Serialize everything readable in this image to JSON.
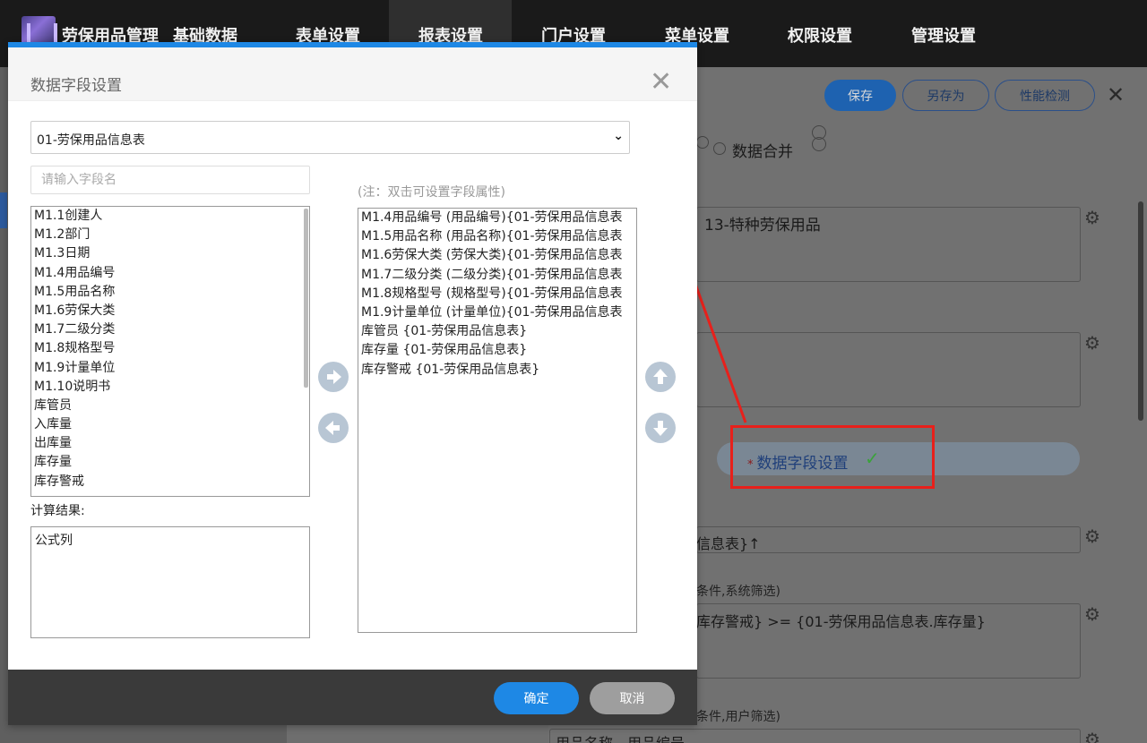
{
  "app": {
    "title": "劳保用品管理",
    "nav": [
      "基础数据",
      "表单设置",
      "报表设置",
      "门户设置",
      "菜单设置",
      "权限设置",
      "管理设置"
    ]
  },
  "background": {
    "buttons": {
      "save": "保存",
      "save_as": "另存为",
      "perf_check": "性能检测"
    },
    "radio_label": "数据合并",
    "field1_value": "13-特种劳保用品",
    "data_field_setting": "数据字段设置",
    "required_star": "*",
    "field3_value": "信息表}↑",
    "cond1_label": "条件,系统筛选)",
    "cond1_value": "库存警戒} >= {01-劳保用品信息表.库存量}",
    "cond2_label": "条件,用户筛选)",
    "cond2_value": "用品名称，用品编号"
  },
  "modal": {
    "title": "数据字段设置",
    "table_select": "01-劳保用品信息表",
    "search_placeholder": "请输入字段名",
    "note": "(注：双击可设置字段属性)",
    "available_fields": [
      "M1.1创建人",
      "M1.2部门",
      "M1.3日期",
      "M1.4用品编号",
      "M1.5用品名称",
      "M1.6劳保大类",
      "M1.7二级分类",
      "M1.8规格型号",
      "M1.9计量单位",
      "M1.10说明书",
      "库管员",
      "入库量",
      "出库量",
      "库存量",
      "库存警戒"
    ],
    "selected_fields": [
      "M1.4用品编号 (用品编号){01-劳保用品信息表",
      "M1.5用品名称 (用品名称){01-劳保用品信息表",
      "M1.6劳保大类 (劳保大类){01-劳保用品信息表",
      "M1.7二级分类 (二级分类){01-劳保用品信息表",
      "M1.8规格型号 (规格型号){01-劳保用品信息表",
      "M1.9计量单位 (计量单位){01-劳保用品信息表",
      "库管员 {01-劳保用品信息表}",
      "库存量 {01-劳保用品信息表}",
      "库存警戒 {01-劳保用品信息表}"
    ],
    "calc_label": "计算结果:",
    "formula_items": [
      "公式列"
    ],
    "ok": "确定",
    "cancel": "取消"
  },
  "colors": {
    "accent": "#1e88e5",
    "annotation": "#e8201b",
    "check": "#3aa23a"
  },
  "icons": [
    "arrow-right-icon",
    "arrow-left-icon",
    "arrow-up-icon",
    "arrow-down-icon",
    "close-icon",
    "gear-icon",
    "check-icon",
    "chevron-down-icon"
  ]
}
